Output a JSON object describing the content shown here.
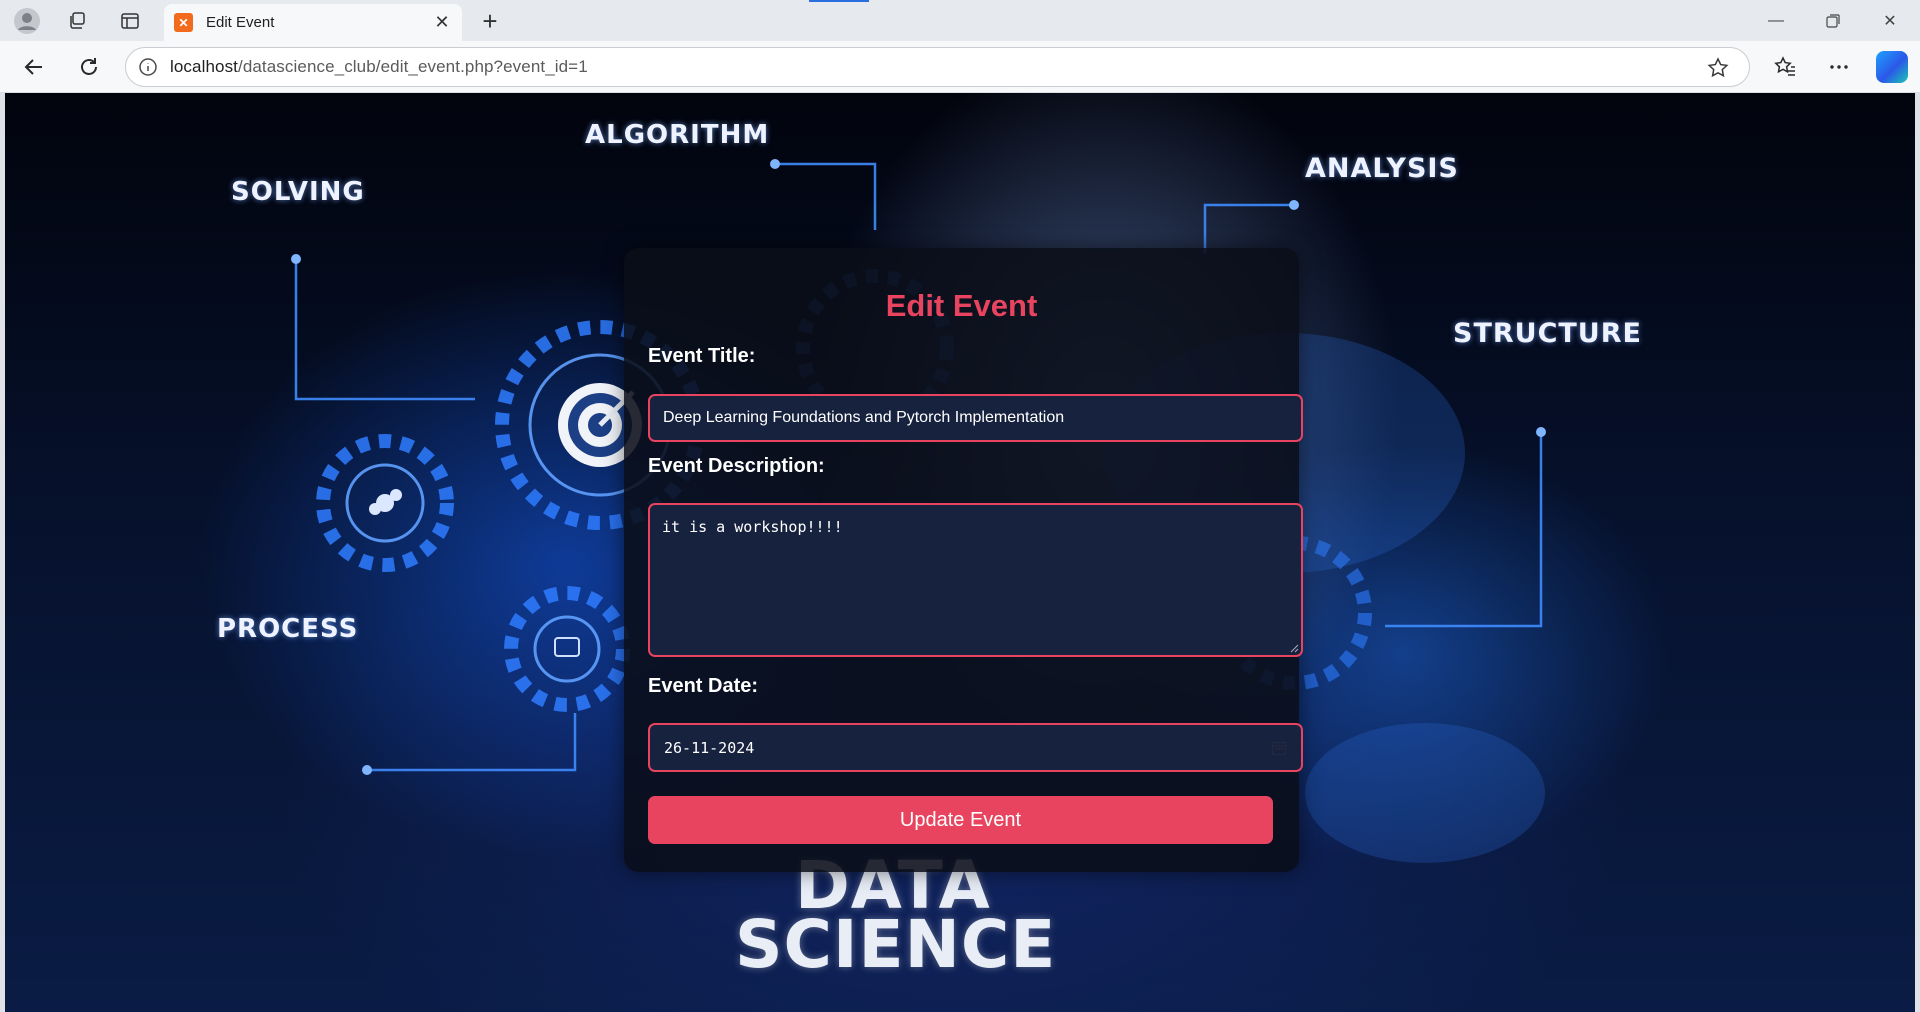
{
  "browser": {
    "tab_title": "Edit Event",
    "url_host": "localhost",
    "url_path": "/datascience_club/edit_event.php?event_id=1"
  },
  "background": {
    "labels": {
      "solving": "SOLVING",
      "algorithm": "ALGORITHM",
      "analysis": "ANALYSIS",
      "structure": "STRUCTURE",
      "process": "PROCESS"
    },
    "brand_line1": "DATA",
    "brand_line2": "SCIENCE"
  },
  "form": {
    "heading": "Edit Event",
    "title_label": "Event Title:",
    "title_value": "Deep Learning Foundations and Pytorch Implementation",
    "description_label": "Event Description:",
    "description_value": "it is a workshop!!!!",
    "date_label": "Event Date:",
    "date_value": "26-11-2024",
    "submit_label": "Update Event"
  },
  "colors": {
    "accent": "#e8445f",
    "field_bg": "#17223f",
    "card_bg": "#0a0e18"
  }
}
